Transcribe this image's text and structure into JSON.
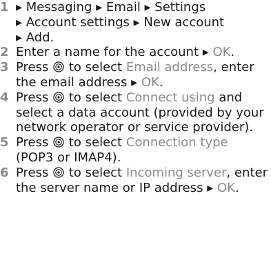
{
  "steps": [
    {
      "num": "1",
      "lines": [
        [
          "▸ Messaging ▸ Email ▸ Settings"
        ],
        [
          "▸ Account settings ▸ New account"
        ],
        [
          "▸ Add."
        ]
      ]
    },
    {
      "num": "2",
      "text_a": "Enter a name for the account ▸ ",
      "hl_a": "OK",
      "text_b": "."
    },
    {
      "num": "3",
      "text_a": "Press ",
      "text_b": " to select ",
      "hl_a": "Email address",
      "text_c": ", enter the email address ▸ ",
      "hl_b": "OK",
      "text_d": "."
    },
    {
      "num": "4",
      "text_a": "Press ",
      "text_b": " to select ",
      "hl_a": "Connect using",
      "text_c": " and select a data account (provided by your network operator or service provider)."
    },
    {
      "num": "5",
      "text_a": "Press ",
      "text_b": " to select ",
      "hl_a": "Connection type",
      "text_c": " (POP3 or IMAP4)."
    },
    {
      "num": "6",
      "text_a": "Press ",
      "text_b": " to select ",
      "hl_a": "Incoming server",
      "text_c": ", enter the server name or IP address ▸ ",
      "hl_b": "OK",
      "text_d": "."
    }
  ],
  "icons": {
    "navigation_key": "navigation-key-icon"
  },
  "colors": {
    "text": "#1a1a1a",
    "highlight": "#8a8a8a"
  }
}
